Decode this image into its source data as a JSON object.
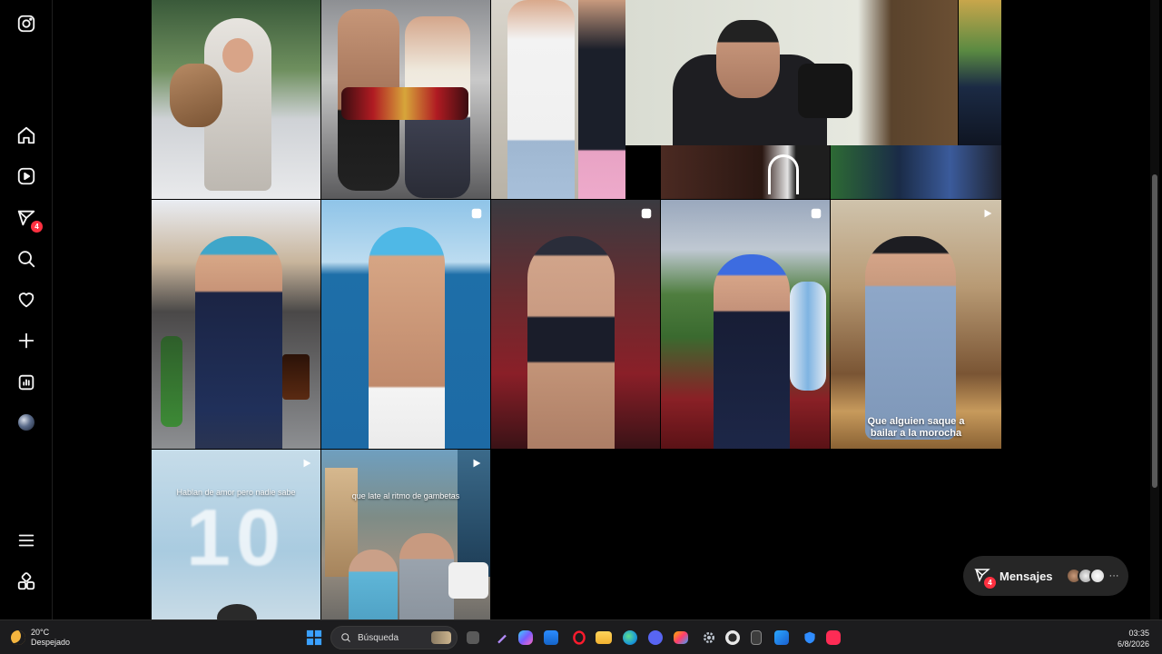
{
  "nav": {
    "items": [
      {
        "name": "instagram-logo-icon"
      },
      {
        "name": "home-icon"
      },
      {
        "name": "reels-icon"
      },
      {
        "name": "messages-icon",
        "badge": "4"
      },
      {
        "name": "search-icon"
      },
      {
        "name": "notifications-heart-icon"
      },
      {
        "name": "create-plus-icon"
      },
      {
        "name": "dashboard-icon"
      },
      {
        "name": "profile-avatar"
      },
      {
        "name": "more-menu-icon"
      },
      {
        "name": "also-from-meta-icon"
      }
    ]
  },
  "grid": {
    "tiles": [
      {
        "caption": ""
      },
      {
        "caption": ""
      },
      {
        "caption": ""
      },
      {
        "caption": ""
      },
      {
        "caption": ""
      },
      {
        "caption": "",
        "reel": true
      },
      {
        "caption": "",
        "reel": true
      },
      {
        "caption": "",
        "reel": true
      },
      {
        "caption": "",
        "reel": true
      },
      {
        "caption": "Que alguien saque a bailar a la morocha",
        "reel": true
      },
      {
        "caption": "Hablan de amor pero nadie sabe",
        "reel": true
      },
      {
        "caption": "que late al ritmo de gambetas",
        "reel": true
      }
    ]
  },
  "messages": {
    "label": "Mensajes",
    "badge": "4",
    "more": "···"
  },
  "taskbar": {
    "weather_temp": "20°C",
    "weather_desc": "Despejado",
    "search_placeholder": "Búsqueda",
    "time": "03:35",
    "date": "6/8/2026"
  },
  "colors": {
    "background": "#000000",
    "badge": "#ff3040",
    "messages_pill": "#262626"
  }
}
